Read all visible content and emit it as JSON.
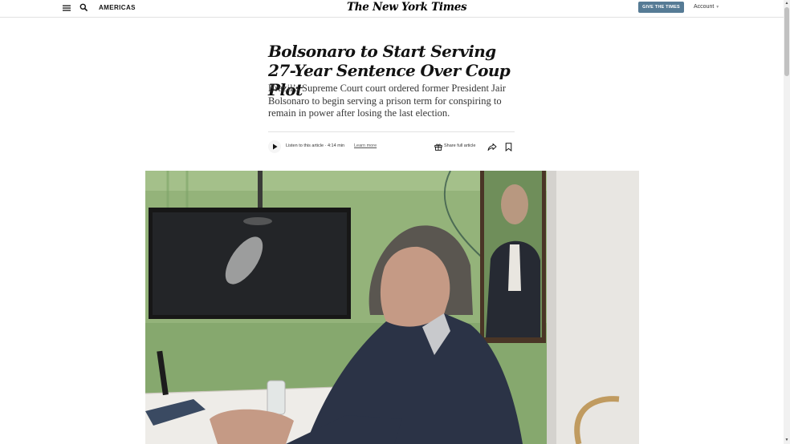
{
  "header": {
    "section_label": "AMERICAS",
    "logo_text": "The New York Times",
    "give_button_label": "GIVE THE TIMES",
    "account_label": "Account"
  },
  "article": {
    "headline": "Bolsonaro to Start Serving 27-Year Sentence Over Coup Plot",
    "summary": "Brazil’s Supreme Court court ordered former President Jair Bolsonaro to begin serving a prison term for conspiring to remain in power after losing the last election."
  },
  "audio": {
    "listen_label": "Listen to this article · 4:14 min",
    "learn_more_label": "Learn more"
  },
  "tools": {
    "share_full_label": "Share full article"
  },
  "icons": {
    "menu": "menu-icon",
    "search": "search-icon",
    "play": "play-icon",
    "gift": "gift-icon",
    "share": "share-icon",
    "bookmark": "bookmark-icon"
  },
  "colors": {
    "give_button_bg": "#567b95",
    "text": "#121212",
    "photo_wall_green": "#8fb076",
    "suit_navy": "#2b3346"
  }
}
